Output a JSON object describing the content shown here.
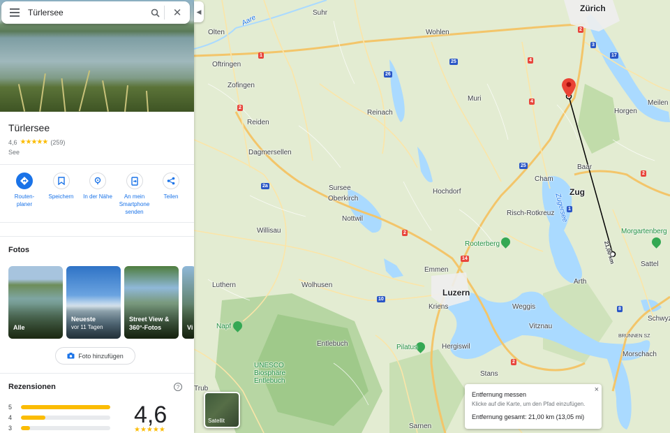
{
  "search": {
    "query": "Türlersee"
  },
  "place": {
    "name": "Türlersee",
    "rating": "4,6",
    "stars": "★★★★★",
    "review_count": "(259)",
    "category": "See"
  },
  "actions": [
    {
      "label": "Routen-\nplaner",
      "icon": "directions-icon"
    },
    {
      "label": "Speichern",
      "icon": "bookmark-icon"
    },
    {
      "label": "In der Nähe",
      "icon": "nearby-icon"
    },
    {
      "label": "An mein\nSmartphone\nsenden",
      "icon": "send-to-phone-icon"
    },
    {
      "label": "Teilen",
      "icon": "share-icon"
    }
  ],
  "photos_section": {
    "title": "Fotos",
    "items": [
      {
        "label": "Alle",
        "sub": ""
      },
      {
        "label": "Neueste",
        "sub": "vor 11 Tagen"
      },
      {
        "label": "Street View &\n360°-Fotos",
        "sub": ""
      },
      {
        "label": "Vi",
        "sub": ""
      }
    ],
    "add_photo": "Foto hinzufügen"
  },
  "reviews": {
    "title": "Rezensionen",
    "score": "4,6",
    "stars": "★★★★★",
    "distribution": [
      {
        "stars": "5",
        "fraction": 1.0
      },
      {
        "stars": "4",
        "fraction": 0.27
      },
      {
        "stars": "3",
        "fraction": 0.1
      }
    ]
  },
  "map": {
    "cities": {
      "zurich": "Zürich",
      "luzern": "Luzern",
      "zug": "Zug"
    },
    "places": {
      "suhr": "Suhr",
      "olten": "Olten",
      "wohlen": "Wohlen",
      "oftringen": "Oftringen",
      "zofingen": "Zofingen",
      "reinach": "Reinach",
      "muri": "Muri",
      "horgen": "Horgen",
      "meilen": "Meilen",
      "reiden": "Reiden",
      "dagmersellen": "Dagmersellen",
      "baar": "Baar",
      "cham": "Cham",
      "sursee": "Sursee",
      "oberkirch": "Oberkirch",
      "nottwil": "Nottwil",
      "hochdorf": "Hochdorf",
      "risch": "Risch-Rotkreuz",
      "willisau": "Willisau",
      "emmen": "Emmen",
      "luthern": "Luthern",
      "wolhusen": "Wolhusen",
      "kriens": "Kriens",
      "weggis": "Weggis",
      "vitznau": "Vitznau",
      "arth": "Arth",
      "sattel": "Sattel",
      "schwyz": "Schwyz",
      "brunnen": "BRUNNEN SZ",
      "morschach": "Morschach",
      "hergiswil": "Hergiswil",
      "stans": "Stans",
      "entlebuch": "Entlebuch",
      "trub": "Trub",
      "sarnen": "Sarnen"
    },
    "water": {
      "aare": "Aare",
      "zugersee": "Zugersee"
    },
    "pois": {
      "rooterberg": "Rooterberg",
      "morgartenberg": "Morgartenberg",
      "napf": "Napf",
      "pilatus": "Pilatus"
    },
    "unesco": "UNESCO\nBiosphäre\nEntlebuch",
    "distance_label": "21,00 km",
    "shields": [
      "1",
      "2",
      "26",
      "25",
      "14",
      "10",
      "2",
      "2",
      "4",
      "2",
      "3",
      "17",
      "4",
      "25",
      "2a",
      "1",
      "8",
      "4",
      "2"
    ],
    "satellite_label": "Satellit"
  },
  "measure": {
    "title": "Entfernung messen",
    "hint": "Klicke auf die Karte, um den Pfad einzufügen.",
    "total": "Entfernung gesamt: 21,00 km (13,05 mi)"
  }
}
